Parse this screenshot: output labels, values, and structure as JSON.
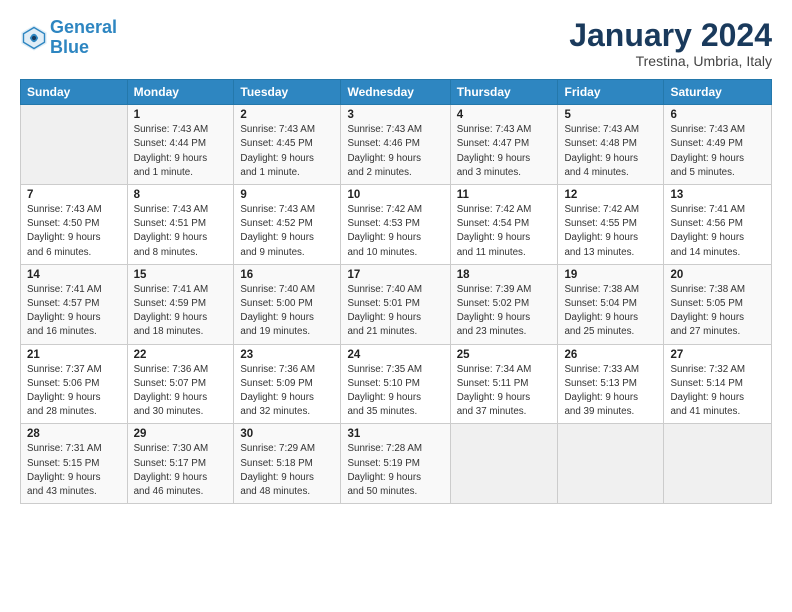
{
  "logo": {
    "line1": "General",
    "line2": "Blue"
  },
  "title": "January 2024",
  "location": "Trestina, Umbria, Italy",
  "days_header": [
    "Sunday",
    "Monday",
    "Tuesday",
    "Wednesday",
    "Thursday",
    "Friday",
    "Saturday"
  ],
  "weeks": [
    [
      {
        "num": "",
        "detail": ""
      },
      {
        "num": "1",
        "detail": "Sunrise: 7:43 AM\nSunset: 4:44 PM\nDaylight: 9 hours\nand 1 minute."
      },
      {
        "num": "2",
        "detail": "Sunrise: 7:43 AM\nSunset: 4:45 PM\nDaylight: 9 hours\nand 1 minute."
      },
      {
        "num": "3",
        "detail": "Sunrise: 7:43 AM\nSunset: 4:46 PM\nDaylight: 9 hours\nand 2 minutes."
      },
      {
        "num": "4",
        "detail": "Sunrise: 7:43 AM\nSunset: 4:47 PM\nDaylight: 9 hours\nand 3 minutes."
      },
      {
        "num": "5",
        "detail": "Sunrise: 7:43 AM\nSunset: 4:48 PM\nDaylight: 9 hours\nand 4 minutes."
      },
      {
        "num": "6",
        "detail": "Sunrise: 7:43 AM\nSunset: 4:49 PM\nDaylight: 9 hours\nand 5 minutes."
      }
    ],
    [
      {
        "num": "7",
        "detail": "Sunrise: 7:43 AM\nSunset: 4:50 PM\nDaylight: 9 hours\nand 6 minutes."
      },
      {
        "num": "8",
        "detail": "Sunrise: 7:43 AM\nSunset: 4:51 PM\nDaylight: 9 hours\nand 8 minutes."
      },
      {
        "num": "9",
        "detail": "Sunrise: 7:43 AM\nSunset: 4:52 PM\nDaylight: 9 hours\nand 9 minutes."
      },
      {
        "num": "10",
        "detail": "Sunrise: 7:42 AM\nSunset: 4:53 PM\nDaylight: 9 hours\nand 10 minutes."
      },
      {
        "num": "11",
        "detail": "Sunrise: 7:42 AM\nSunset: 4:54 PM\nDaylight: 9 hours\nand 11 minutes."
      },
      {
        "num": "12",
        "detail": "Sunrise: 7:42 AM\nSunset: 4:55 PM\nDaylight: 9 hours\nand 13 minutes."
      },
      {
        "num": "13",
        "detail": "Sunrise: 7:41 AM\nSunset: 4:56 PM\nDaylight: 9 hours\nand 14 minutes."
      }
    ],
    [
      {
        "num": "14",
        "detail": "Sunrise: 7:41 AM\nSunset: 4:57 PM\nDaylight: 9 hours\nand 16 minutes."
      },
      {
        "num": "15",
        "detail": "Sunrise: 7:41 AM\nSunset: 4:59 PM\nDaylight: 9 hours\nand 18 minutes."
      },
      {
        "num": "16",
        "detail": "Sunrise: 7:40 AM\nSunset: 5:00 PM\nDaylight: 9 hours\nand 19 minutes."
      },
      {
        "num": "17",
        "detail": "Sunrise: 7:40 AM\nSunset: 5:01 PM\nDaylight: 9 hours\nand 21 minutes."
      },
      {
        "num": "18",
        "detail": "Sunrise: 7:39 AM\nSunset: 5:02 PM\nDaylight: 9 hours\nand 23 minutes."
      },
      {
        "num": "19",
        "detail": "Sunrise: 7:38 AM\nSunset: 5:04 PM\nDaylight: 9 hours\nand 25 minutes."
      },
      {
        "num": "20",
        "detail": "Sunrise: 7:38 AM\nSunset: 5:05 PM\nDaylight: 9 hours\nand 27 minutes."
      }
    ],
    [
      {
        "num": "21",
        "detail": "Sunrise: 7:37 AM\nSunset: 5:06 PM\nDaylight: 9 hours\nand 28 minutes."
      },
      {
        "num": "22",
        "detail": "Sunrise: 7:36 AM\nSunset: 5:07 PM\nDaylight: 9 hours\nand 30 minutes."
      },
      {
        "num": "23",
        "detail": "Sunrise: 7:36 AM\nSunset: 5:09 PM\nDaylight: 9 hours\nand 32 minutes."
      },
      {
        "num": "24",
        "detail": "Sunrise: 7:35 AM\nSunset: 5:10 PM\nDaylight: 9 hours\nand 35 minutes."
      },
      {
        "num": "25",
        "detail": "Sunrise: 7:34 AM\nSunset: 5:11 PM\nDaylight: 9 hours\nand 37 minutes."
      },
      {
        "num": "26",
        "detail": "Sunrise: 7:33 AM\nSunset: 5:13 PM\nDaylight: 9 hours\nand 39 minutes."
      },
      {
        "num": "27",
        "detail": "Sunrise: 7:32 AM\nSunset: 5:14 PM\nDaylight: 9 hours\nand 41 minutes."
      }
    ],
    [
      {
        "num": "28",
        "detail": "Sunrise: 7:31 AM\nSunset: 5:15 PM\nDaylight: 9 hours\nand 43 minutes."
      },
      {
        "num": "29",
        "detail": "Sunrise: 7:30 AM\nSunset: 5:17 PM\nDaylight: 9 hours\nand 46 minutes."
      },
      {
        "num": "30",
        "detail": "Sunrise: 7:29 AM\nSunset: 5:18 PM\nDaylight: 9 hours\nand 48 minutes."
      },
      {
        "num": "31",
        "detail": "Sunrise: 7:28 AM\nSunset: 5:19 PM\nDaylight: 9 hours\nand 50 minutes."
      },
      {
        "num": "",
        "detail": ""
      },
      {
        "num": "",
        "detail": ""
      },
      {
        "num": "",
        "detail": ""
      }
    ]
  ]
}
